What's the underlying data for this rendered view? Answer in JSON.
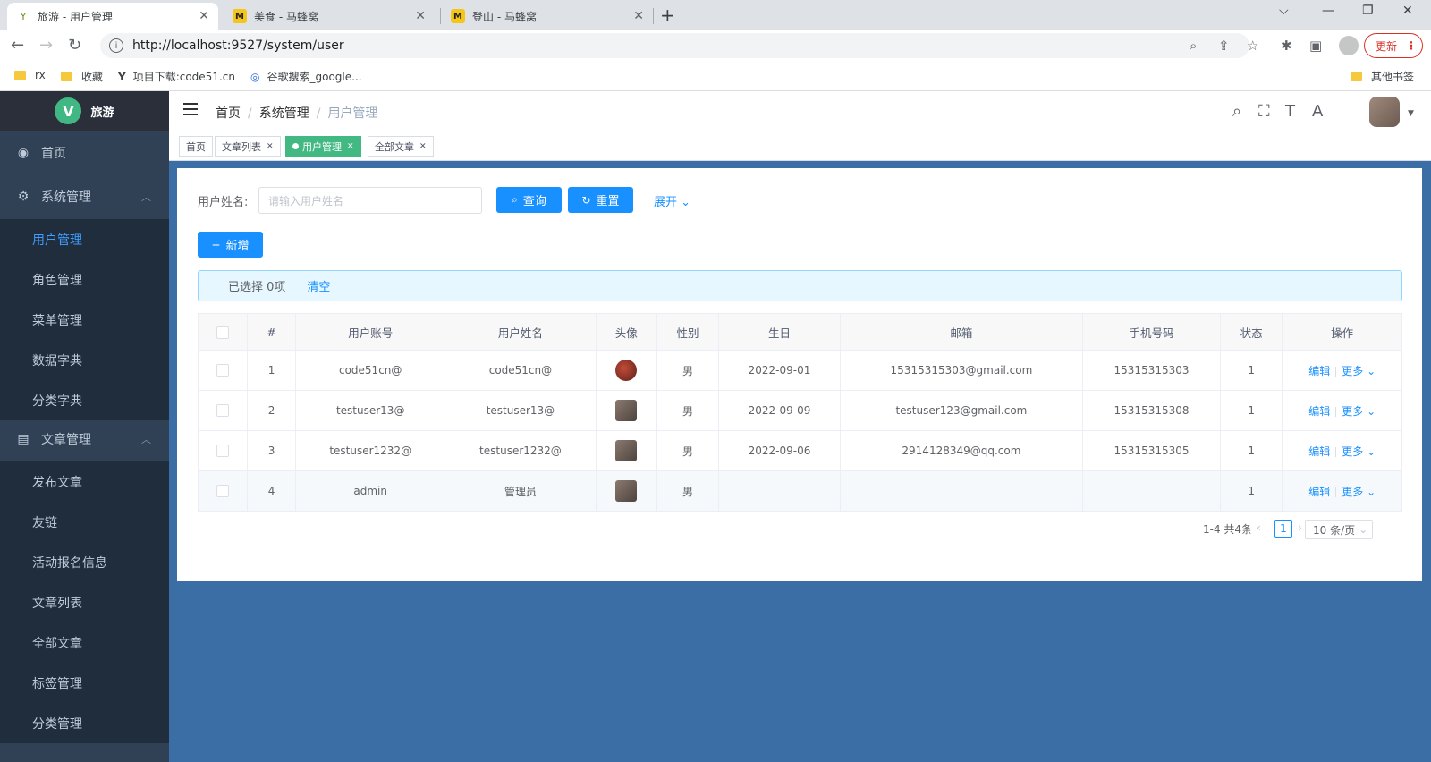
{
  "browser": {
    "tabs": [
      {
        "title": "旅游 - 用户管理",
        "active": true
      },
      {
        "title": "美食 - 马蜂窝",
        "active": false
      },
      {
        "title": "登山 - 马蜂窝",
        "active": false
      }
    ],
    "url": "http://localhost:9527/system/user",
    "update_label": "更新",
    "bookmarks": [
      "rx",
      "收藏",
      "项目下载:code51.cn",
      "谷歌搜索_google..."
    ],
    "other_bookmarks": "其他书签"
  },
  "app": {
    "logo_text": "旅游",
    "sidebar": {
      "home": "首页",
      "system_group": "系统管理",
      "system_items": [
        "用户管理",
        "角色管理",
        "菜单管理",
        "数据字典",
        "分类字典"
      ],
      "article_group": "文章管理",
      "article_items": [
        "发布文章",
        "友链",
        "活动报名信息",
        "文章列表",
        "全部文章",
        "标签管理",
        "分类管理"
      ]
    },
    "breadcrumb": [
      "首页",
      "系统管理",
      "用户管理"
    ],
    "tags": [
      "首页",
      "文章列表",
      "用户管理",
      "全部文章"
    ]
  },
  "search": {
    "label": "用户姓名:",
    "placeholder": "请输入用户姓名",
    "query_label": "查询",
    "reset_label": "重置",
    "expand_label": "展开"
  },
  "add_label": "新增",
  "selection": {
    "text": "已选择 0项",
    "clear": "清空"
  },
  "table": {
    "headers": [
      "#",
      "用户账号",
      "用户姓名",
      "头像",
      "性别",
      "生日",
      "邮箱",
      "手机号码",
      "状态",
      "操作"
    ],
    "rows": [
      {
        "idx": "1",
        "account": "code51cn@",
        "name": "code51cn@",
        "gender": "男",
        "birthday": "2022-09-01",
        "email": "15315315303@gmail.com",
        "phone": "15315315303",
        "status": "1"
      },
      {
        "idx": "2",
        "account": "testuser13@",
        "name": "testuser13@",
        "gender": "男",
        "birthday": "2022-09-09",
        "email": "testuser123@gmail.com",
        "phone": "15315315308",
        "status": "1"
      },
      {
        "idx": "3",
        "account": "testuser1232@",
        "name": "testuser1232@",
        "gender": "男",
        "birthday": "2022-09-06",
        "email": "2914128349@qq.com",
        "phone": "15315315305",
        "status": "1"
      },
      {
        "idx": "4",
        "account": "admin",
        "name": "管理员",
        "gender": "男",
        "birthday": "",
        "email": "",
        "phone": "",
        "status": "1"
      }
    ],
    "edit_label": "编辑",
    "more_label": "更多"
  },
  "pagination": {
    "summary": "1-4 共4条",
    "current": "1",
    "page_size": "10 条/页"
  }
}
